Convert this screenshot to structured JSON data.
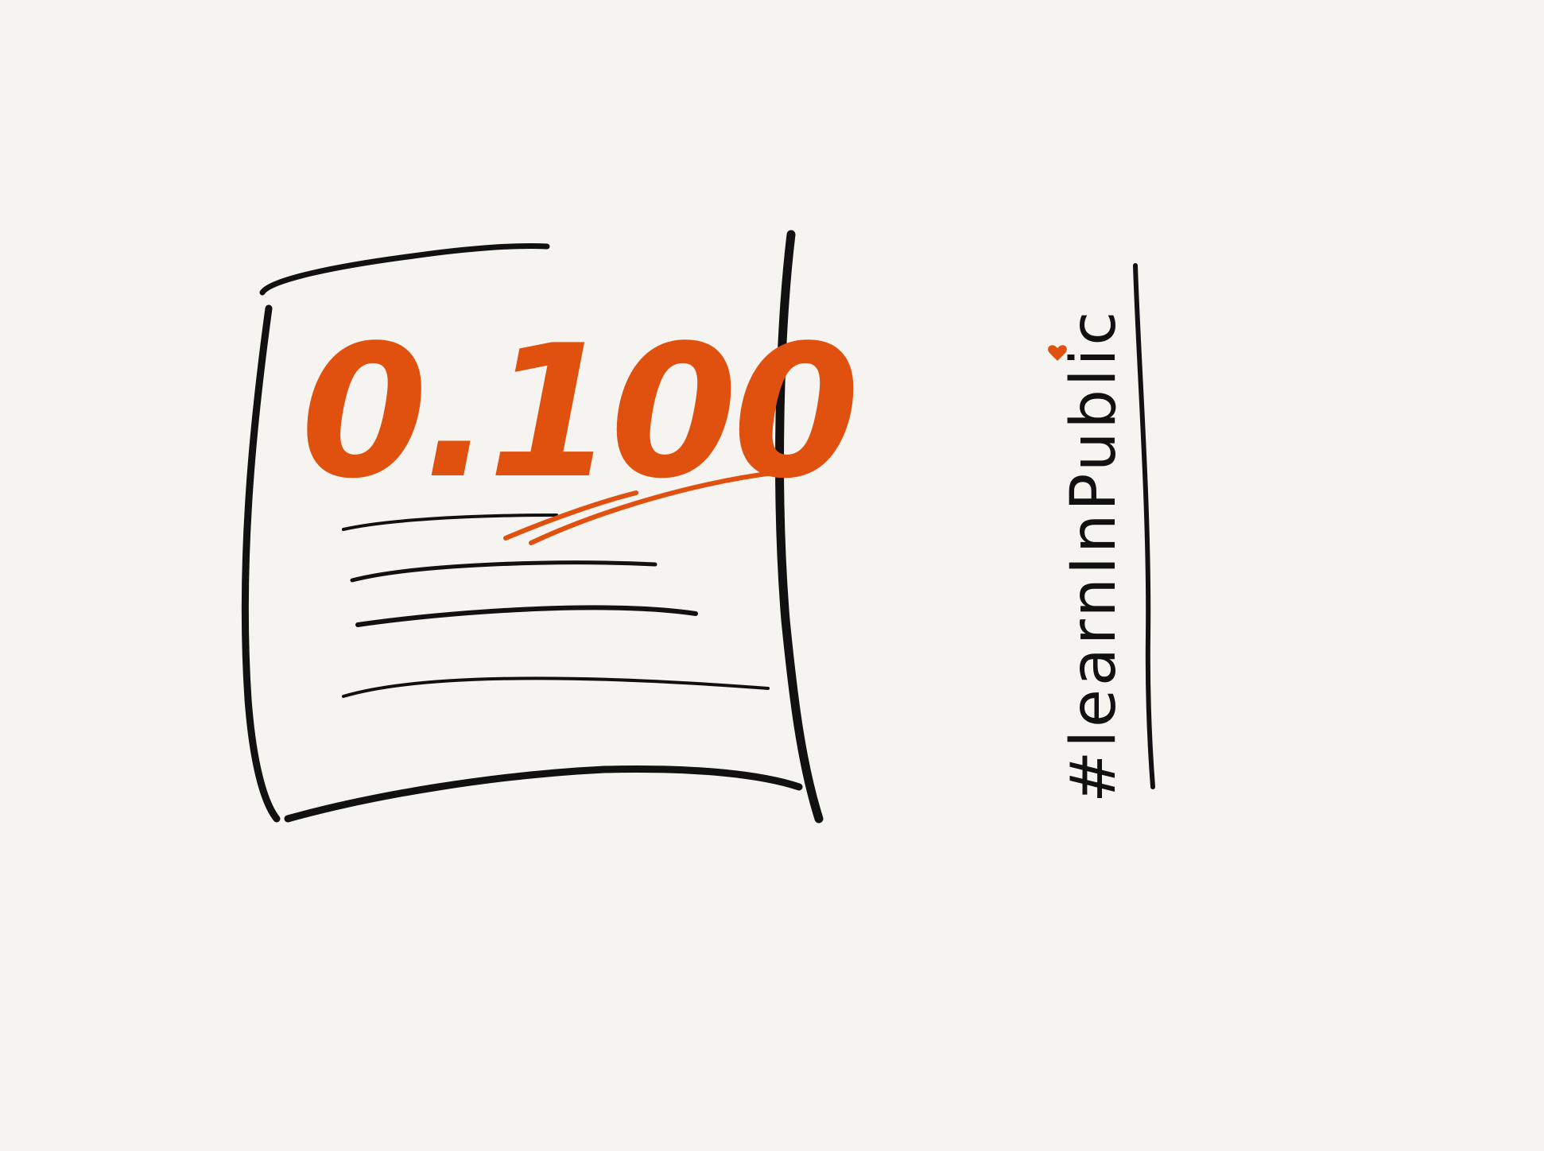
{
  "sketch": {
    "score": "0.100",
    "hashtag": "#learnInPublic",
    "colors": {
      "background": "#f5f4f0",
      "ink": "#111111",
      "accent": "#e0500f"
    }
  }
}
